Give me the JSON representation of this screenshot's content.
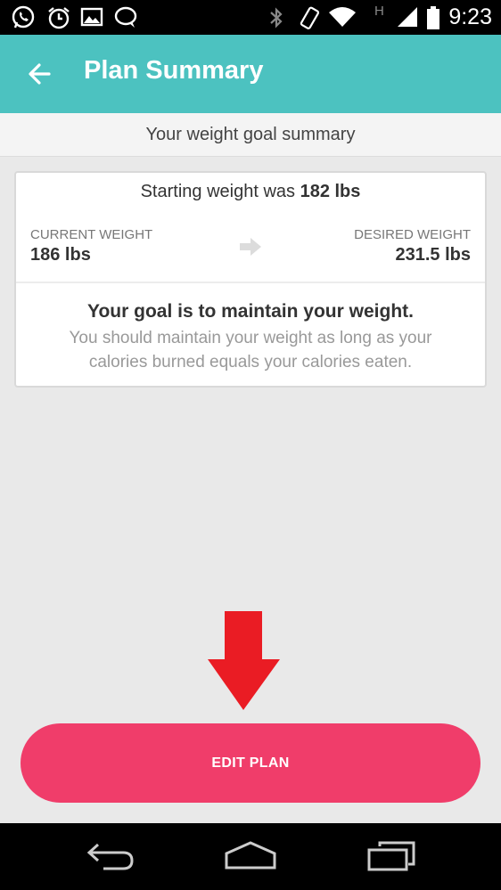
{
  "status_bar": {
    "time": "9:23",
    "left_icons": [
      "whatsapp-icon",
      "alarm-icon",
      "gallery-icon",
      "chat-icon"
    ],
    "right_icons": [
      "bluetooth-icon",
      "vibrate-icon",
      "wifi-icon",
      "network-h-icon",
      "signal-icon",
      "battery-icon"
    ],
    "network_type": "H"
  },
  "app_bar": {
    "title": "Plan Summary",
    "color": "#4cc2c0"
  },
  "subheader": {
    "text": "Your weight goal summary"
  },
  "card": {
    "starting_prefix": "Starting weight was ",
    "starting_value": "182 lbs",
    "current_label": "CURRENT WEIGHT",
    "current_value": "186 lbs",
    "desired_label": "DESIRED WEIGHT",
    "desired_value": "231.5 lbs",
    "goal_title": "Your goal is to maintain your weight.",
    "goal_desc": "You should maintain your weight as long as your calories burned equals your calories eaten."
  },
  "edit_button": {
    "label": "EDIT PLAN",
    "color": "#f03d6a"
  },
  "annotation": {
    "color": "#ea1c24"
  },
  "nav_bar": {
    "buttons": [
      "back-nav-icon",
      "home-nav-icon",
      "recents-nav-icon"
    ]
  }
}
